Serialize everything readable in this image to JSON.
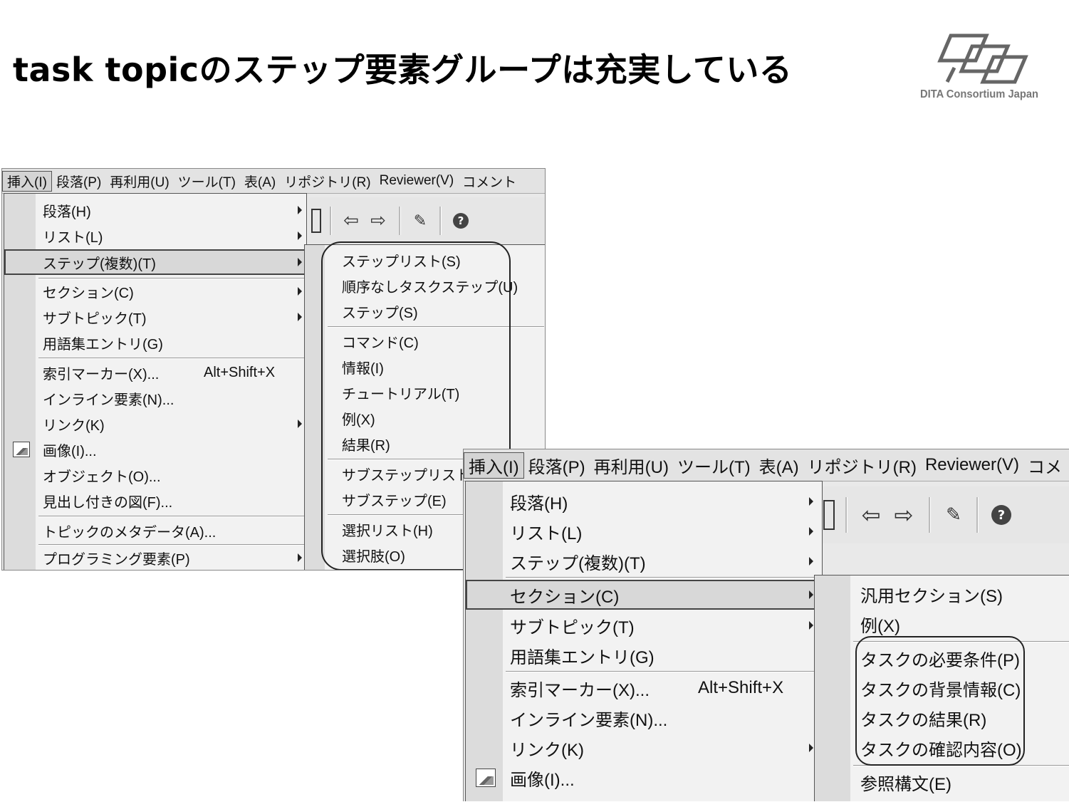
{
  "slide": {
    "title": "task topicのステップ要素グループは充実している",
    "logo_text": "DITA Consortium Japan"
  },
  "menubar": [
    "挿入(I)",
    "段落(P)",
    "再利用(U)",
    "ツール(T)",
    "表(A)",
    "リポジトリ(R)",
    "Reviewer(V)",
    "コメント"
  ],
  "menubar_short_last": "コメ",
  "insert_menu": [
    {
      "label": "段落(H)",
      "arrow": true
    },
    {
      "label": "リスト(L)",
      "arrow": true
    },
    {
      "label": "ステップ(複数)(T)",
      "arrow": true
    },
    {
      "label": "セクション(C)",
      "arrow": true
    },
    {
      "label": "サブトピック(T)",
      "arrow": true
    },
    {
      "label": "用語集エントリ(G)",
      "arrow": false
    },
    {
      "label": "索引マーカー(X)...",
      "shortcut": "Alt+Shift+X"
    },
    {
      "label": "インライン要素(N)...",
      "arrow": false
    },
    {
      "label": "リンク(K)",
      "arrow": true
    },
    {
      "label": "画像(I)...",
      "arrow": false
    },
    {
      "label": "オブジェクト(O)...",
      "arrow": false
    },
    {
      "label": "見出し付きの図(F)...",
      "arrow": false
    },
    {
      "label": "トピックのメタデータ(A)...",
      "arrow": false
    },
    {
      "label": "プログラミング要素(P)",
      "arrow": true
    }
  ],
  "steps_submenu": [
    "ステップリスト(S)",
    "順序なしタスクステップ(U)",
    "ステップ(S)",
    "コマンド(C)",
    "情報(I)",
    "チュートリアル(T)",
    "例(X)",
    "結果(R)",
    "サブステップリスト(B)",
    "サブステップ(E)",
    "選択リスト(H)",
    "選択肢(O)"
  ],
  "section_submenu": [
    "汎用セクション(S)",
    "例(X)",
    "タスクの必要条件(P)",
    "タスクの背景情報(C)",
    "タスクの結果(R)",
    "タスクの確認内容(O)",
    "参照構文(E)"
  ],
  "toolbar_icons": [
    "rectangle-icon",
    "back-arrow-icon",
    "forward-arrow-icon",
    "edit-document-icon",
    "help-icon"
  ]
}
